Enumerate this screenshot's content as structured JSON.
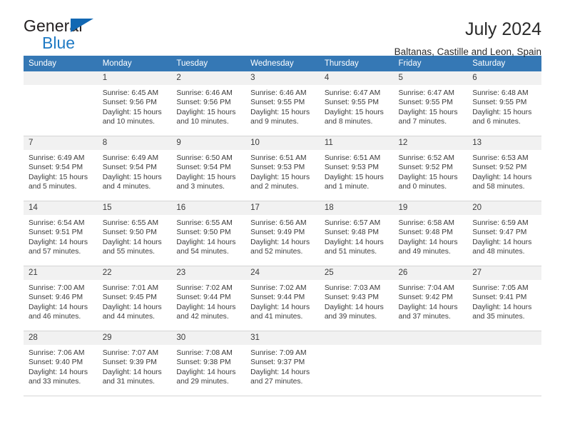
{
  "brand": {
    "name_top": "General",
    "name_bottom": "Blue",
    "triangle_color": "#1268b3",
    "blue_color": "#1f7ac4"
  },
  "header": {
    "title": "July 2024",
    "subtitle": "Baltanas, Castille and Leon, Spain"
  },
  "theme": {
    "header_bg": "#3578b5",
    "daynum_bg": "#f1f1f1",
    "cell_bg": "#ffffff",
    "border": "#d5d5d5"
  },
  "weekdays": [
    "Sunday",
    "Monday",
    "Tuesday",
    "Wednesday",
    "Thursday",
    "Friday",
    "Saturday"
  ],
  "weeks": [
    [
      {
        "day": "",
        "blank": true,
        "sunrise": "",
        "sunset": "",
        "daylight1": "",
        "daylight2": ""
      },
      {
        "day": "1",
        "sunrise": "Sunrise: 6:45 AM",
        "sunset": "Sunset: 9:56 PM",
        "daylight1": "Daylight: 15 hours",
        "daylight2": "and 10 minutes."
      },
      {
        "day": "2",
        "sunrise": "Sunrise: 6:46 AM",
        "sunset": "Sunset: 9:56 PM",
        "daylight1": "Daylight: 15 hours",
        "daylight2": "and 10 minutes."
      },
      {
        "day": "3",
        "sunrise": "Sunrise: 6:46 AM",
        "sunset": "Sunset: 9:55 PM",
        "daylight1": "Daylight: 15 hours",
        "daylight2": "and 9 minutes."
      },
      {
        "day": "4",
        "sunrise": "Sunrise: 6:47 AM",
        "sunset": "Sunset: 9:55 PM",
        "daylight1": "Daylight: 15 hours",
        "daylight2": "and 8 minutes."
      },
      {
        "day": "5",
        "sunrise": "Sunrise: 6:47 AM",
        "sunset": "Sunset: 9:55 PM",
        "daylight1": "Daylight: 15 hours",
        "daylight2": "and 7 minutes."
      },
      {
        "day": "6",
        "sunrise": "Sunrise: 6:48 AM",
        "sunset": "Sunset: 9:55 PM",
        "daylight1": "Daylight: 15 hours",
        "daylight2": "and 6 minutes."
      }
    ],
    [
      {
        "day": "7",
        "sunrise": "Sunrise: 6:49 AM",
        "sunset": "Sunset: 9:54 PM",
        "daylight1": "Daylight: 15 hours",
        "daylight2": "and 5 minutes."
      },
      {
        "day": "8",
        "sunrise": "Sunrise: 6:49 AM",
        "sunset": "Sunset: 9:54 PM",
        "daylight1": "Daylight: 15 hours",
        "daylight2": "and 4 minutes."
      },
      {
        "day": "9",
        "sunrise": "Sunrise: 6:50 AM",
        "sunset": "Sunset: 9:54 PM",
        "daylight1": "Daylight: 15 hours",
        "daylight2": "and 3 minutes."
      },
      {
        "day": "10",
        "sunrise": "Sunrise: 6:51 AM",
        "sunset": "Sunset: 9:53 PM",
        "daylight1": "Daylight: 15 hours",
        "daylight2": "and 2 minutes."
      },
      {
        "day": "11",
        "sunrise": "Sunrise: 6:51 AM",
        "sunset": "Sunset: 9:53 PM",
        "daylight1": "Daylight: 15 hours",
        "daylight2": "and 1 minute."
      },
      {
        "day": "12",
        "sunrise": "Sunrise: 6:52 AM",
        "sunset": "Sunset: 9:52 PM",
        "daylight1": "Daylight: 15 hours",
        "daylight2": "and 0 minutes."
      },
      {
        "day": "13",
        "sunrise": "Sunrise: 6:53 AM",
        "sunset": "Sunset: 9:52 PM",
        "daylight1": "Daylight: 14 hours",
        "daylight2": "and 58 minutes."
      }
    ],
    [
      {
        "day": "14",
        "sunrise": "Sunrise: 6:54 AM",
        "sunset": "Sunset: 9:51 PM",
        "daylight1": "Daylight: 14 hours",
        "daylight2": "and 57 minutes."
      },
      {
        "day": "15",
        "sunrise": "Sunrise: 6:55 AM",
        "sunset": "Sunset: 9:50 PM",
        "daylight1": "Daylight: 14 hours",
        "daylight2": "and 55 minutes."
      },
      {
        "day": "16",
        "sunrise": "Sunrise: 6:55 AM",
        "sunset": "Sunset: 9:50 PM",
        "daylight1": "Daylight: 14 hours",
        "daylight2": "and 54 minutes."
      },
      {
        "day": "17",
        "sunrise": "Sunrise: 6:56 AM",
        "sunset": "Sunset: 9:49 PM",
        "daylight1": "Daylight: 14 hours",
        "daylight2": "and 52 minutes."
      },
      {
        "day": "18",
        "sunrise": "Sunrise: 6:57 AM",
        "sunset": "Sunset: 9:48 PM",
        "daylight1": "Daylight: 14 hours",
        "daylight2": "and 51 minutes."
      },
      {
        "day": "19",
        "sunrise": "Sunrise: 6:58 AM",
        "sunset": "Sunset: 9:48 PM",
        "daylight1": "Daylight: 14 hours",
        "daylight2": "and 49 minutes."
      },
      {
        "day": "20",
        "sunrise": "Sunrise: 6:59 AM",
        "sunset": "Sunset: 9:47 PM",
        "daylight1": "Daylight: 14 hours",
        "daylight2": "and 48 minutes."
      }
    ],
    [
      {
        "day": "21",
        "sunrise": "Sunrise: 7:00 AM",
        "sunset": "Sunset: 9:46 PM",
        "daylight1": "Daylight: 14 hours",
        "daylight2": "and 46 minutes."
      },
      {
        "day": "22",
        "sunrise": "Sunrise: 7:01 AM",
        "sunset": "Sunset: 9:45 PM",
        "daylight1": "Daylight: 14 hours",
        "daylight2": "and 44 minutes."
      },
      {
        "day": "23",
        "sunrise": "Sunrise: 7:02 AM",
        "sunset": "Sunset: 9:44 PM",
        "daylight1": "Daylight: 14 hours",
        "daylight2": "and 42 minutes."
      },
      {
        "day": "24",
        "sunrise": "Sunrise: 7:02 AM",
        "sunset": "Sunset: 9:44 PM",
        "daylight1": "Daylight: 14 hours",
        "daylight2": "and 41 minutes."
      },
      {
        "day": "25",
        "sunrise": "Sunrise: 7:03 AM",
        "sunset": "Sunset: 9:43 PM",
        "daylight1": "Daylight: 14 hours",
        "daylight2": "and 39 minutes."
      },
      {
        "day": "26",
        "sunrise": "Sunrise: 7:04 AM",
        "sunset": "Sunset: 9:42 PM",
        "daylight1": "Daylight: 14 hours",
        "daylight2": "and 37 minutes."
      },
      {
        "day": "27",
        "sunrise": "Sunrise: 7:05 AM",
        "sunset": "Sunset: 9:41 PM",
        "daylight1": "Daylight: 14 hours",
        "daylight2": "and 35 minutes."
      }
    ],
    [
      {
        "day": "28",
        "sunrise": "Sunrise: 7:06 AM",
        "sunset": "Sunset: 9:40 PM",
        "daylight1": "Daylight: 14 hours",
        "daylight2": "and 33 minutes."
      },
      {
        "day": "29",
        "sunrise": "Sunrise: 7:07 AM",
        "sunset": "Sunset: 9:39 PM",
        "daylight1": "Daylight: 14 hours",
        "daylight2": "and 31 minutes."
      },
      {
        "day": "30",
        "sunrise": "Sunrise: 7:08 AM",
        "sunset": "Sunset: 9:38 PM",
        "daylight1": "Daylight: 14 hours",
        "daylight2": "and 29 minutes."
      },
      {
        "day": "31",
        "sunrise": "Sunrise: 7:09 AM",
        "sunset": "Sunset: 9:37 PM",
        "daylight1": "Daylight: 14 hours",
        "daylight2": "and 27 minutes."
      },
      {
        "day": "",
        "blank": true,
        "sunrise": "",
        "sunset": "",
        "daylight1": "",
        "daylight2": ""
      },
      {
        "day": "",
        "blank": true,
        "sunrise": "",
        "sunset": "",
        "daylight1": "",
        "daylight2": ""
      },
      {
        "day": "",
        "blank": true,
        "sunrise": "",
        "sunset": "",
        "daylight1": "",
        "daylight2": ""
      }
    ]
  ]
}
